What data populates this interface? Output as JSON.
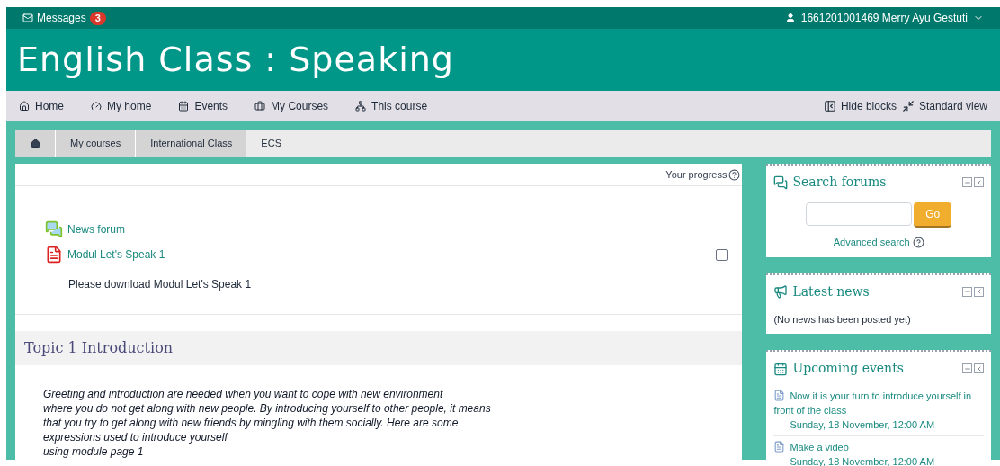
{
  "top_bar": {
    "messages_label": "Messages",
    "messages_count": "3",
    "user": "1661201001469 Merry Ayu Gestuti"
  },
  "header": {
    "title": "English Class : Speaking"
  },
  "nav": {
    "items": [
      {
        "label": "Home",
        "kind": "home"
      },
      {
        "label": "My home",
        "kind": "dashboard"
      },
      {
        "label": "Events",
        "kind": "calendar"
      },
      {
        "label": "My Courses",
        "kind": "briefcase"
      },
      {
        "label": "This course",
        "kind": "sitemap"
      }
    ],
    "actions": [
      {
        "label": "Hide blocks",
        "kind": "hide"
      },
      {
        "label": "Standard view",
        "kind": "compress"
      }
    ]
  },
  "breadcrumb": [
    "My courses",
    "International Class",
    "ECS"
  ],
  "course": {
    "progress_label": "Your progress",
    "activities": [
      {
        "name": "News forum",
        "kind": "forum"
      },
      {
        "name": "Modul Let's Speak 1",
        "kind": "pdf",
        "completion": {
          "checked": false
        }
      }
    ],
    "description": "Please download Modul Let's Speak 1",
    "topic": {
      "title": "Topic 1 Introduction",
      "lines": [
        "Greeting and introduction are needed when you want to cope with new environment",
        "where you do not get along with new people. By introducing yourself to other people, it means",
        "that you try to get along with new friends by mingling with them socially. Here are some",
        "expressions used to introduce yourself",
        "using module page 1"
      ]
    }
  },
  "blocks": [
    {
      "kind": "search",
      "title": "Search forums",
      "button": "Go",
      "link": "Advanced search"
    },
    {
      "kind": "news",
      "title": "Latest news",
      "text": "(No news has been posted yet)"
    },
    {
      "kind": "events",
      "title": "Upcoming events",
      "events": [
        {
          "name": "Now it is your turn to introduce yourself in front of the class",
          "date": "Sunday, 18 November, 12:00 AM"
        },
        {
          "name": "Make a video",
          "date": "Sunday, 18 November, 12:00 AM"
        }
      ]
    }
  ]
}
